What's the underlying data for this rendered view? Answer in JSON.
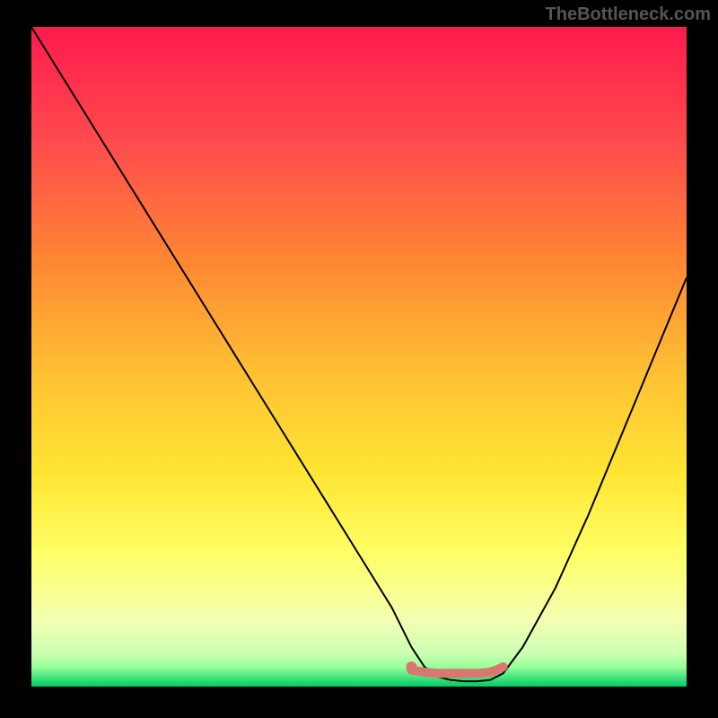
{
  "watermark": "TheBottleneck.com",
  "chart_data": {
    "type": "line",
    "title": "",
    "xlabel": "",
    "ylabel": "",
    "xlim": [
      0,
      100
    ],
    "ylim": [
      0,
      100
    ],
    "background_gradient": {
      "top": "#ff1a4d",
      "mid1": "#ff9933",
      "mid2": "#ffd633",
      "mid3": "#ffff66",
      "mid4": "#e6ffb3",
      "bottom": "#00cc66"
    },
    "series": [
      {
        "name": "curve",
        "color": "#000000",
        "x": [
          0,
          5,
          10,
          15,
          20,
          25,
          30,
          35,
          40,
          45,
          50,
          55,
          58,
          60,
          62,
          64,
          66,
          68,
          70,
          72,
          75,
          80,
          85,
          90,
          95,
          100
        ],
        "y": [
          100,
          92,
          84,
          76,
          68,
          60,
          52,
          44,
          36,
          28,
          20,
          12,
          6,
          3,
          1.5,
          1,
          0.8,
          0.8,
          1,
          2,
          6,
          15,
          26,
          38,
          50,
          62
        ]
      },
      {
        "name": "highlight",
        "color": "#d97770",
        "x": [
          58,
          60,
          62,
          64,
          66,
          68,
          70,
          71,
          72
        ],
        "y": [
          2.5,
          2.2,
          2,
          2,
          2,
          2,
          2.2,
          2.5,
          3
        ]
      }
    ],
    "highlight_dot": {
      "x": 58,
      "y": 3,
      "color": "#d97770"
    }
  }
}
